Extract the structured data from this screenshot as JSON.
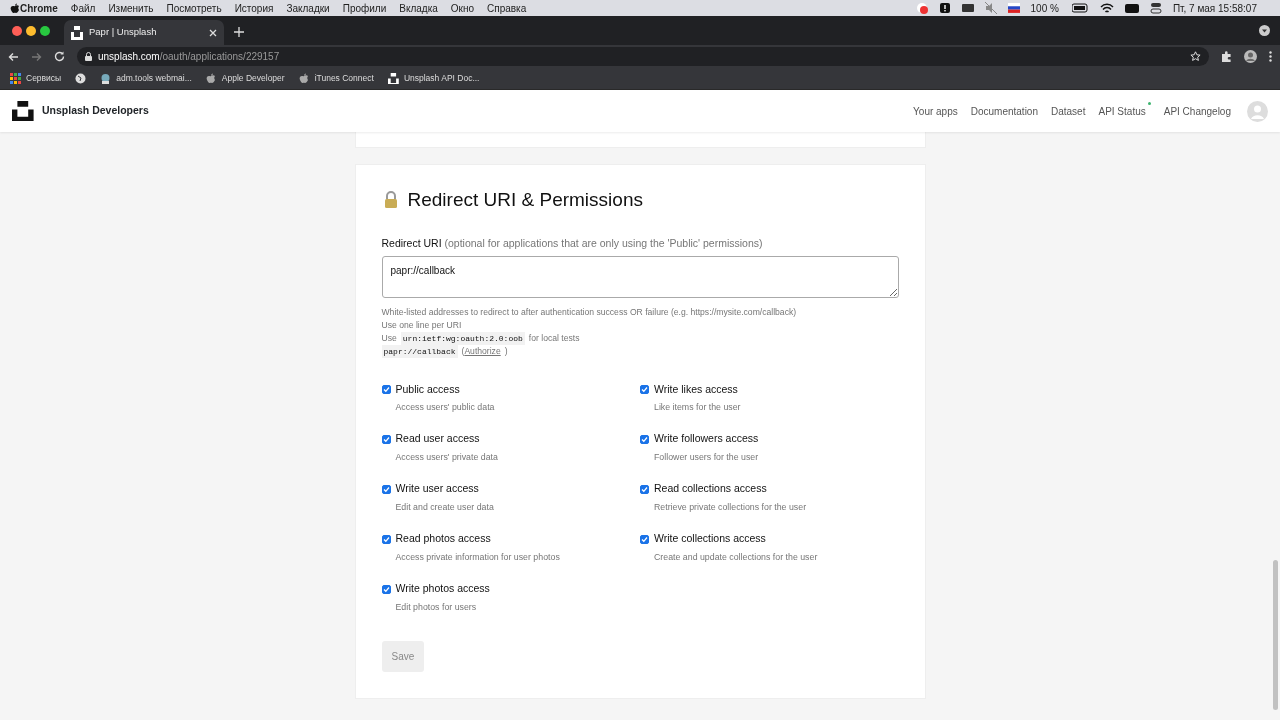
{
  "menu_bar": {
    "app": "Chrome",
    "items": [
      "Файл",
      "Изменить",
      "Посмотреть",
      "История",
      "Закладки",
      "Профили",
      "Вкладка",
      "Окно",
      "Справка"
    ],
    "battery": "100 %",
    "clock": "Пт, 7 мая  15:58:07"
  },
  "tabs": [
    {
      "title": "Papr | Unsplash",
      "selected": true
    }
  ],
  "address_bar": {
    "host": "unsplash.com",
    "path": "/oauth/applications/229157"
  },
  "bookmarks": [
    {
      "label": "Сервисы",
      "kind": "apps"
    },
    {
      "kind": "globe"
    },
    {
      "label": "adm.tools webmai...",
      "kind": "site"
    },
    {
      "label": "Apple Developer",
      "kind": "apple"
    },
    {
      "label": "iTunes Connect",
      "kind": "apple"
    },
    {
      "label": "Unsplash API Doc...",
      "kind": "unsplash"
    }
  ],
  "site_nav": {
    "brand": "Unsplash Developers",
    "links": [
      {
        "label": "Your apps",
        "dot": false
      },
      {
        "label": "Documentation",
        "dot": false
      },
      {
        "label": "Dataset",
        "dot": false
      },
      {
        "label": "API Status",
        "dot": true
      },
      {
        "label": "API Changelog",
        "dot": false
      }
    ]
  },
  "section": {
    "title": "Redirect URI & Permissions",
    "redirect_label": "Redirect URI",
    "redirect_hint": "(optional for applications that are only using the 'Public' permissions)",
    "redirect_value": "papr://callback",
    "help": [
      [
        {
          "kind": "text",
          "text": "White-listed addresses to redirect to after authentication success OR failure (e.g. https://mysite.com/callback)"
        }
      ],
      [
        {
          "kind": "text",
          "text": "Use one line per URI"
        }
      ],
      [
        {
          "kind": "text",
          "text": "Use"
        },
        {
          "kind": "code",
          "text": "urn:ietf:wg:oauth:2.0:oob"
        },
        {
          "kind": "text",
          "text": "for local tests"
        }
      ],
      [
        {
          "kind": "code",
          "text": "papr://callback"
        },
        {
          "kind": "text",
          "text": "("
        },
        {
          "kind": "link",
          "text": "Authorize"
        },
        {
          "kind": "text",
          "text": ")"
        }
      ]
    ],
    "permission_columns": [
      [
        {
          "label": "Public access",
          "description": "Access users' public data",
          "checked": true
        },
        {
          "label": "Read user access",
          "description": "Access users' private data",
          "checked": true
        },
        {
          "label": "Write user access",
          "description": "Edit and create user data",
          "checked": true
        },
        {
          "label": "Read photos access",
          "description": "Access private information for user photos",
          "checked": true
        },
        {
          "label": "Write photos access",
          "description": "Edit photos for users",
          "checked": true
        }
      ],
      [
        {
          "label": "Write likes access",
          "description": "Like items for the user",
          "checked": true
        },
        {
          "label": "Write followers access",
          "description": "Follower users for the user",
          "checked": true
        },
        {
          "label": "Read collections access",
          "description": "Retrieve private collections for the user",
          "checked": true
        },
        {
          "label": "Write collections access",
          "description": "Create and update collections for the user",
          "checked": true
        }
      ]
    ],
    "save_button": {
      "label": "Save",
      "disabled": true
    }
  }
}
